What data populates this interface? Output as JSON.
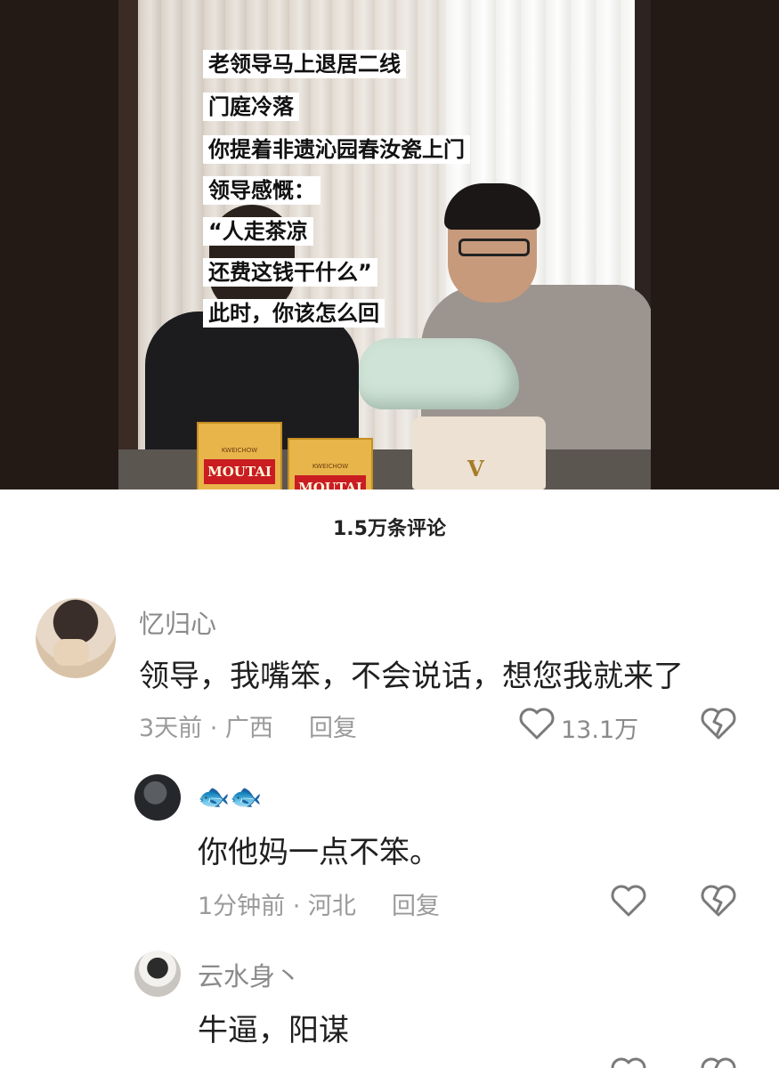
{
  "video": {
    "captions": [
      "老领导马上退居二线",
      "门庭冷落",
      "你提着非遗沁园春汝瓷上门",
      "领导感慨：",
      "“人走茶凉",
      "还费这钱干什么”",
      "此时，你该怎么回"
    ],
    "box_label": "MOUTAI",
    "box_sub": "KWEICHOW"
  },
  "comments_header": "1.5万条评论",
  "comments": [
    {
      "username": "忆归心",
      "text": "领导，我嘴笨，不会说话，想您我就来了",
      "meta": "3天前 · 广西",
      "reply": "回复",
      "likes": "13.1万"
    },
    {
      "username": "🐟🐟",
      "text": "你他妈一点不笨。",
      "meta": "1分钟前 · 河北",
      "reply": "回复"
    },
    {
      "username": "云水身丶",
      "text": "牛逼，阳谋"
    }
  ],
  "colors": {
    "heart": "#7a7a7a",
    "caption_bg": "#ffffff"
  },
  "icons": [
    "heart-outline-icon",
    "broken-heart-icon"
  ]
}
